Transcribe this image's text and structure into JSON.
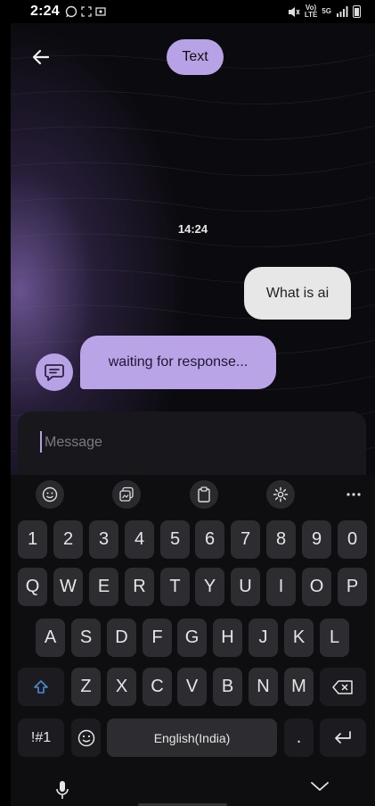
{
  "status_bar": {
    "time": "2:24",
    "network_top": "5G",
    "network_bottom": "LTE",
    "volte": "Vo)"
  },
  "header": {
    "mode_label": "Text"
  },
  "chat": {
    "timestamp": "14:24",
    "messages": [
      {
        "sender": "user",
        "text": "What is ai"
      },
      {
        "sender": "bot",
        "text": "waiting for response..."
      }
    ]
  },
  "composer": {
    "placeholder": "Message"
  },
  "keyboard": {
    "row_numbers": [
      "1",
      "2",
      "3",
      "4",
      "5",
      "6",
      "7",
      "8",
      "9",
      "0"
    ],
    "row_1": [
      "Q",
      "W",
      "E",
      "R",
      "T",
      "Y",
      "U",
      "I",
      "O",
      "P"
    ],
    "row_2": [
      "A",
      "S",
      "D",
      "F",
      "G",
      "H",
      "J",
      "K",
      "L"
    ],
    "row_3": [
      "Z",
      "X",
      "C",
      "V",
      "B",
      "N",
      "M"
    ],
    "symbols_label": "!#1",
    "space_label": "English(India)",
    "period_label": "."
  },
  "colors": {
    "accent": "#b7a2e6",
    "bubble_user": "#e7e7e7",
    "bubble_bot": "#b9a4e8",
    "shift": "#4a8bd6"
  }
}
